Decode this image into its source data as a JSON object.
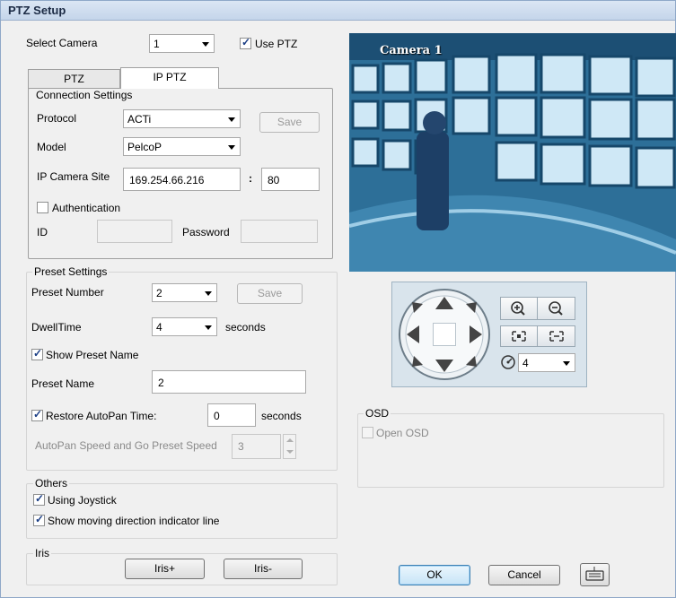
{
  "window": {
    "title": "PTZ Setup"
  },
  "camera": {
    "select_label": "Select Camera",
    "select_value": "1",
    "use_ptz_label": "Use PTZ",
    "use_ptz_checked": true,
    "preview_label": "Camera 1"
  },
  "tabs": [
    {
      "label": "PTZ",
      "active": false
    },
    {
      "label": "IP PTZ",
      "active": true
    }
  ],
  "connection": {
    "title": "Connection Settings",
    "protocol_label": "Protocol",
    "protocol_value": "ACTi",
    "save_label": "Save",
    "model_label": "Model",
    "model_value": "PelcoP",
    "ip_label": "IP Camera Site",
    "ip_value": "169.254.66.216",
    "port_sep": ":",
    "port_value": "80",
    "auth_label": "Authentication",
    "auth_checked": false,
    "id_label": "ID",
    "id_value": "",
    "password_label": "Password",
    "password_value": ""
  },
  "preset": {
    "title": "Preset Settings",
    "number_label": "Preset Number",
    "number_value": "2",
    "save_label": "Save",
    "dwell_label": "DwellTime",
    "dwell_value": "4",
    "dwell_unit": "seconds",
    "show_name_label": "Show Preset Name",
    "show_name_checked": true,
    "name_label": "Preset Name",
    "name_value": "2",
    "restore_label": "Restore AutoPan Time:",
    "restore_checked": true,
    "restore_value": "0",
    "restore_unit": "seconds",
    "speed_label": "AutoPan Speed and Go Preset Speed",
    "speed_value": "3"
  },
  "others": {
    "title": "Others",
    "joystick_label": "Using Joystick",
    "joystick_checked": true,
    "direction_label": "Show moving direction indicator line",
    "direction_checked": true
  },
  "iris": {
    "title": "Iris",
    "plus_label": "Iris+",
    "minus_label": "Iris-"
  },
  "ptz_control": {
    "speed_value": "4"
  },
  "osd": {
    "title": "OSD",
    "open_label": "Open OSD",
    "open_checked": false
  },
  "footer": {
    "ok_label": "OK",
    "cancel_label": "Cancel"
  },
  "colors": {
    "accent": "#3c7fb1",
    "preview_bg": "#2f6f98"
  }
}
